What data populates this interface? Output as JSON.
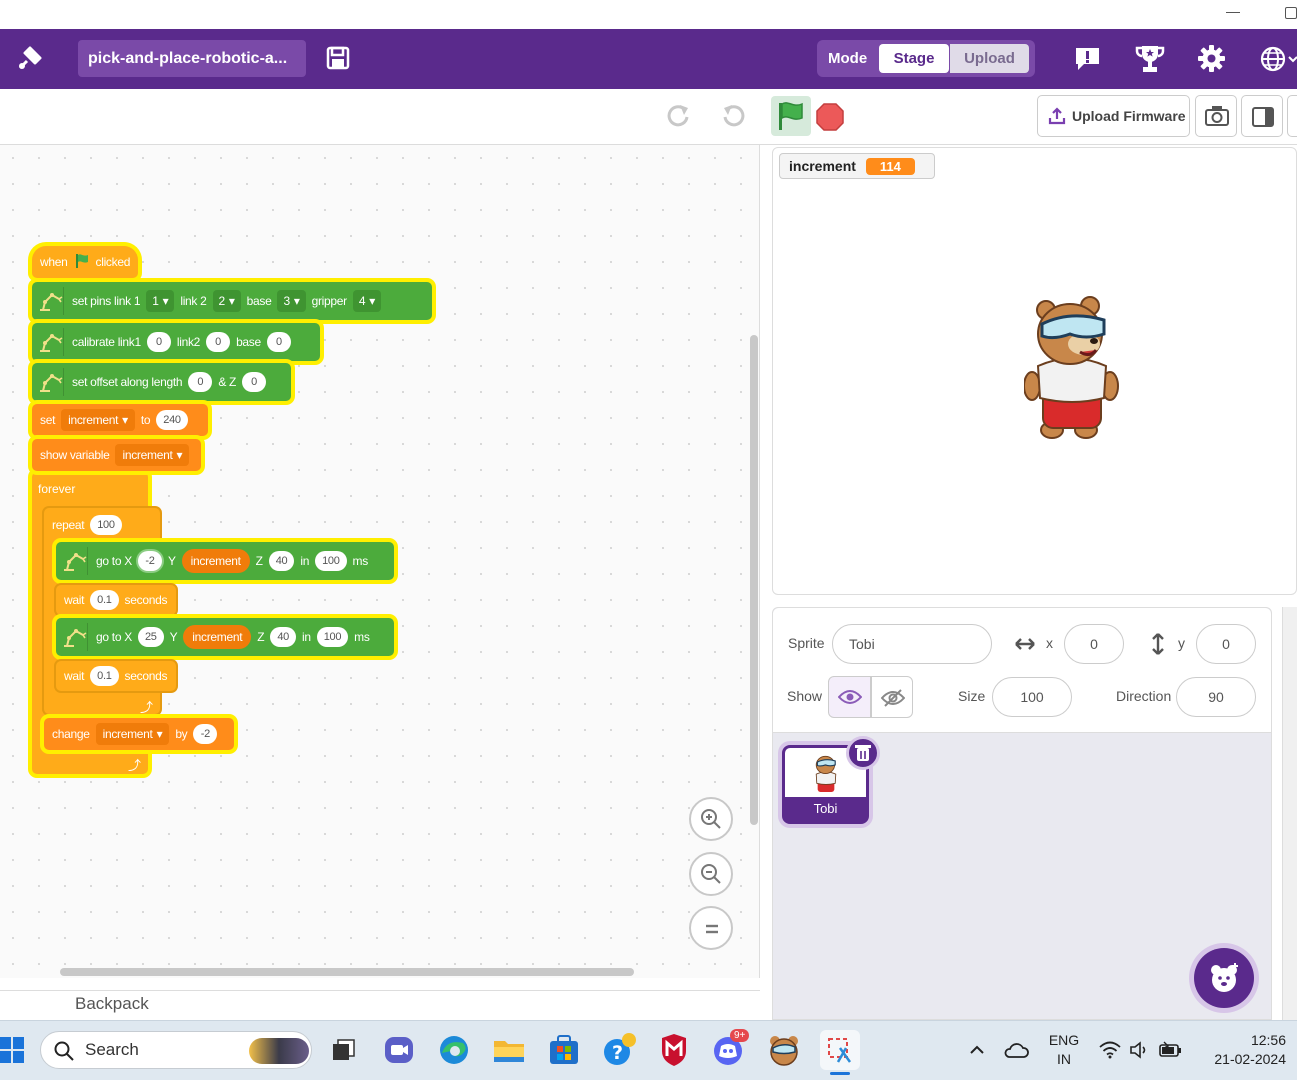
{
  "app": {
    "project_name": "pick-and-place-robotic-a...",
    "mode_label": "Mode",
    "mode_stage": "Stage",
    "mode_upload": "Upload",
    "accent_color": "#5a2a8c"
  },
  "toolbar": {
    "upload_firmware": "Upload Firmware"
  },
  "script": {
    "hat": {
      "when": "when",
      "clicked": "clicked"
    },
    "set_pins": {
      "label": "set pins link 1",
      "link1": "1",
      "link2_label": "link 2",
      "link2": "2",
      "base_label": "base",
      "base": "3",
      "gripper_label": "gripper",
      "gripper": "4"
    },
    "calibrate": {
      "label": "calibrate link1",
      "link1": "0",
      "link2_label": "link2",
      "link2": "0",
      "base_label": "base",
      "base": "0"
    },
    "offset": {
      "label": "set offset along length",
      "length": "0",
      "z_label": "& Z",
      "z": "0"
    },
    "set_var": {
      "label": "set",
      "var": "increment",
      "to_label": "to",
      "value": "240"
    },
    "show_var": {
      "label": "show variable",
      "var": "increment"
    },
    "forever": {
      "label": "forever"
    },
    "repeat": {
      "label": "repeat",
      "count": "100"
    },
    "goto1": {
      "label": "go to X",
      "x": "-2",
      "y_label": "Y",
      "y_var": "increment",
      "z_label": "Z",
      "z": "40",
      "in_label": "in",
      "ms": "100",
      "ms_label": "ms"
    },
    "wait1": {
      "label": "wait",
      "value": "0.1",
      "unit": "seconds"
    },
    "goto2": {
      "label": "go to X",
      "x": "25",
      "y_label": "Y",
      "y_var": "increment",
      "z_label": "Z",
      "z": "40",
      "in_label": "in",
      "ms": "100",
      "ms_label": "ms"
    },
    "wait2": {
      "label": "wait",
      "value": "0.1",
      "unit": "seconds"
    },
    "change": {
      "label": "change",
      "var": "increment",
      "by_label": "by",
      "value": "-2"
    }
  },
  "backpack": {
    "label": "Backpack"
  },
  "stage": {
    "monitor_name": "increment",
    "monitor_value": "114"
  },
  "sprite_info": {
    "sprite_label": "Sprite",
    "sprite_name": "Tobi",
    "x_label": "x",
    "x_value": "0",
    "y_label": "y",
    "y_value": "0",
    "show_label": "Show",
    "size_label": "Size",
    "size_value": "100",
    "direction_label": "Direction",
    "direction_value": "90"
  },
  "sprites": [
    {
      "name": "Tobi"
    }
  ],
  "taskbar": {
    "search_placeholder": "Search",
    "lang_line1": "ENG",
    "lang_line2": "IN",
    "time": "12:56",
    "date": "21-02-2024",
    "discord_badge": "9+"
  }
}
